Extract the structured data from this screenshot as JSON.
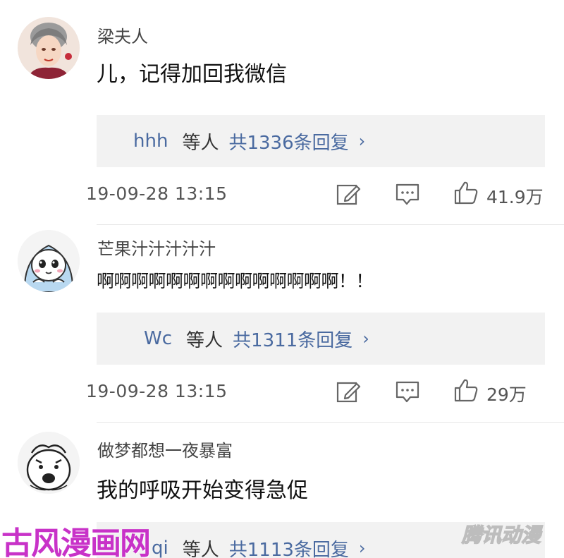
{
  "comments": [
    {
      "username": "梁夫人",
      "text": "儿，记得加回我微信",
      "reply_user": "hhh",
      "reply_mid": "等人",
      "reply_count": "共1336条回复",
      "reply_chevron": "›",
      "timestamp": "19-09-28  13:15",
      "likes": "41.9万"
    },
    {
      "username": "芒果汁汁汁汁汁",
      "text": "啊啊啊啊啊啊啊啊啊啊啊啊啊啊！！",
      "reply_user": "Wc",
      "reply_mid": "等人",
      "reply_count": "共1311条回复",
      "reply_chevron": "›",
      "timestamp": "19-09-28  13:15",
      "likes": "29万"
    },
    {
      "username": "做梦都想一夜暴富",
      "text": "我的呼吸开始变得急促",
      "reply_user": "qi",
      "reply_mid": "等人",
      "reply_count": "共1113条回复",
      "reply_chevron": "›"
    }
  ],
  "watermarks": {
    "left": "古风漫画网",
    "right": "腾讯动漫"
  },
  "colors": {
    "link": "#4a6aa0",
    "reply_bg": "#f2f2f2",
    "meta": "#555555",
    "watermark_left": "#c832c8"
  },
  "icons": [
    "edit-icon",
    "comment-icon",
    "like-icon",
    "chevron-right-icon"
  ]
}
